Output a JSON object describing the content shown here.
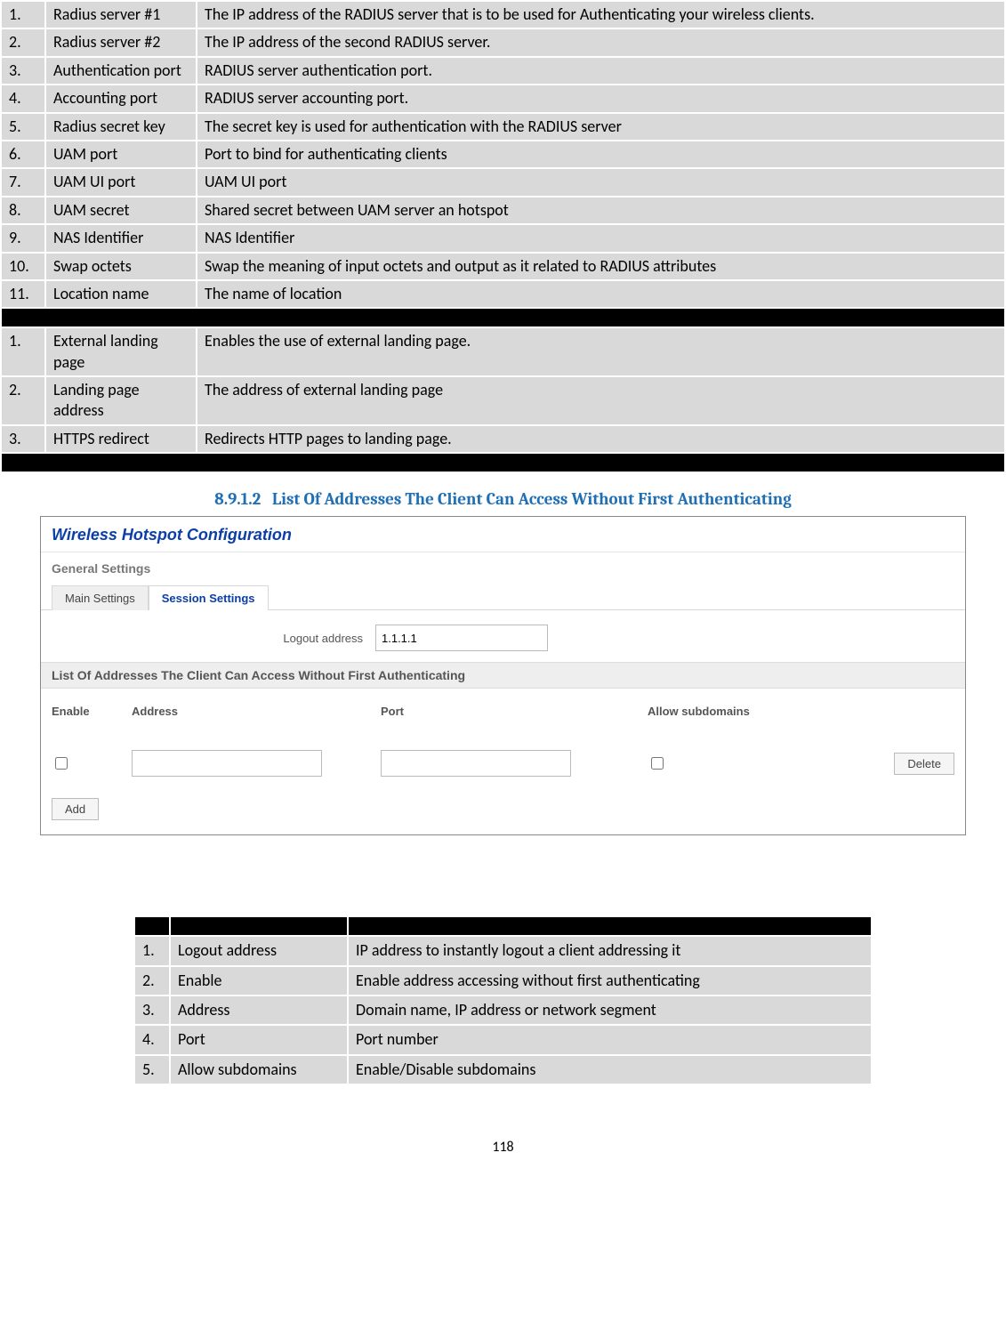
{
  "table1": {
    "sectionA": [
      {
        "n": "1.",
        "name": "Radius server #1",
        "desc": "The IP address of the RADIUS server that is to be used for Authenticating your wireless clients."
      },
      {
        "n": "2.",
        "name": "Radius server #2",
        "desc": "The IP address of the second RADIUS server."
      },
      {
        "n": "3.",
        "name": "Authentication port",
        "desc": "RADIUS server authentication port."
      },
      {
        "n": "4.",
        "name": "Accounting port",
        "desc": "RADIUS server accounting port."
      },
      {
        "n": "5.",
        "name": "Radius secret key",
        "desc": "The secret key is used for authentication with the RADIUS server"
      },
      {
        "n": "6.",
        "name": "UAM port",
        "desc": "Port to bind for authenticating clients"
      },
      {
        "n": "7.",
        "name": "UAM UI port",
        "desc": "UAM UI port"
      },
      {
        "n": "8.",
        "name": "UAM secret",
        "desc": "Shared secret between UAM server an hotspot"
      },
      {
        "n": "9.",
        "name": "NAS Identifier",
        "desc": "NAS Identifier"
      },
      {
        "n": "10.",
        "name": "Swap octets",
        "desc": "Swap the meaning of input octets and output as it related to RADIUS attributes"
      },
      {
        "n": "11.",
        "name": "Location name",
        "desc": "The name of location"
      }
    ],
    "sectionB": [
      {
        "n": "1.",
        "name": "External landing page",
        "desc": "Enables the use of external landing page."
      },
      {
        "n": "2.",
        "name": "Landing page address",
        "desc": "The address of external landing page"
      },
      {
        "n": "3.",
        "name": "HTTPS redirect",
        "desc": "Redirects HTTP pages to landing page."
      }
    ]
  },
  "section_heading_num": "8.9.1.2",
  "section_heading_txt": "List Of Addresses The Client Can Access Without First Authenticating",
  "screenshot": {
    "title": "Wireless Hotspot Configuration",
    "subtitle": "General Settings",
    "tab1": "Main Settings",
    "tab2": "Session Settings",
    "logout_label": "Logout address",
    "logout_value": "1.1.1.1",
    "bar": "List Of Addresses The Client Can Access Without First Authenticating",
    "h_enable": "Enable",
    "h_address": "Address",
    "h_port": "Port",
    "h_allow": "Allow subdomains",
    "btn_delete": "Delete",
    "btn_add": "Add"
  },
  "table2": [
    {
      "n": "1.",
      "name": "Logout address",
      "desc": "IP address to instantly logout a client addressing it"
    },
    {
      "n": "2.",
      "name": "Enable",
      "desc": "Enable address accessing without first authenticating"
    },
    {
      "n": "3.",
      "name": "Address",
      "desc": "Domain name, IP address or network segment"
    },
    {
      "n": "4.",
      "name": "Port",
      "desc": "Port number"
    },
    {
      "n": "5.",
      "name": "Allow subdomains",
      "desc": "Enable/Disable subdomains"
    }
  ],
  "page_number": "118"
}
